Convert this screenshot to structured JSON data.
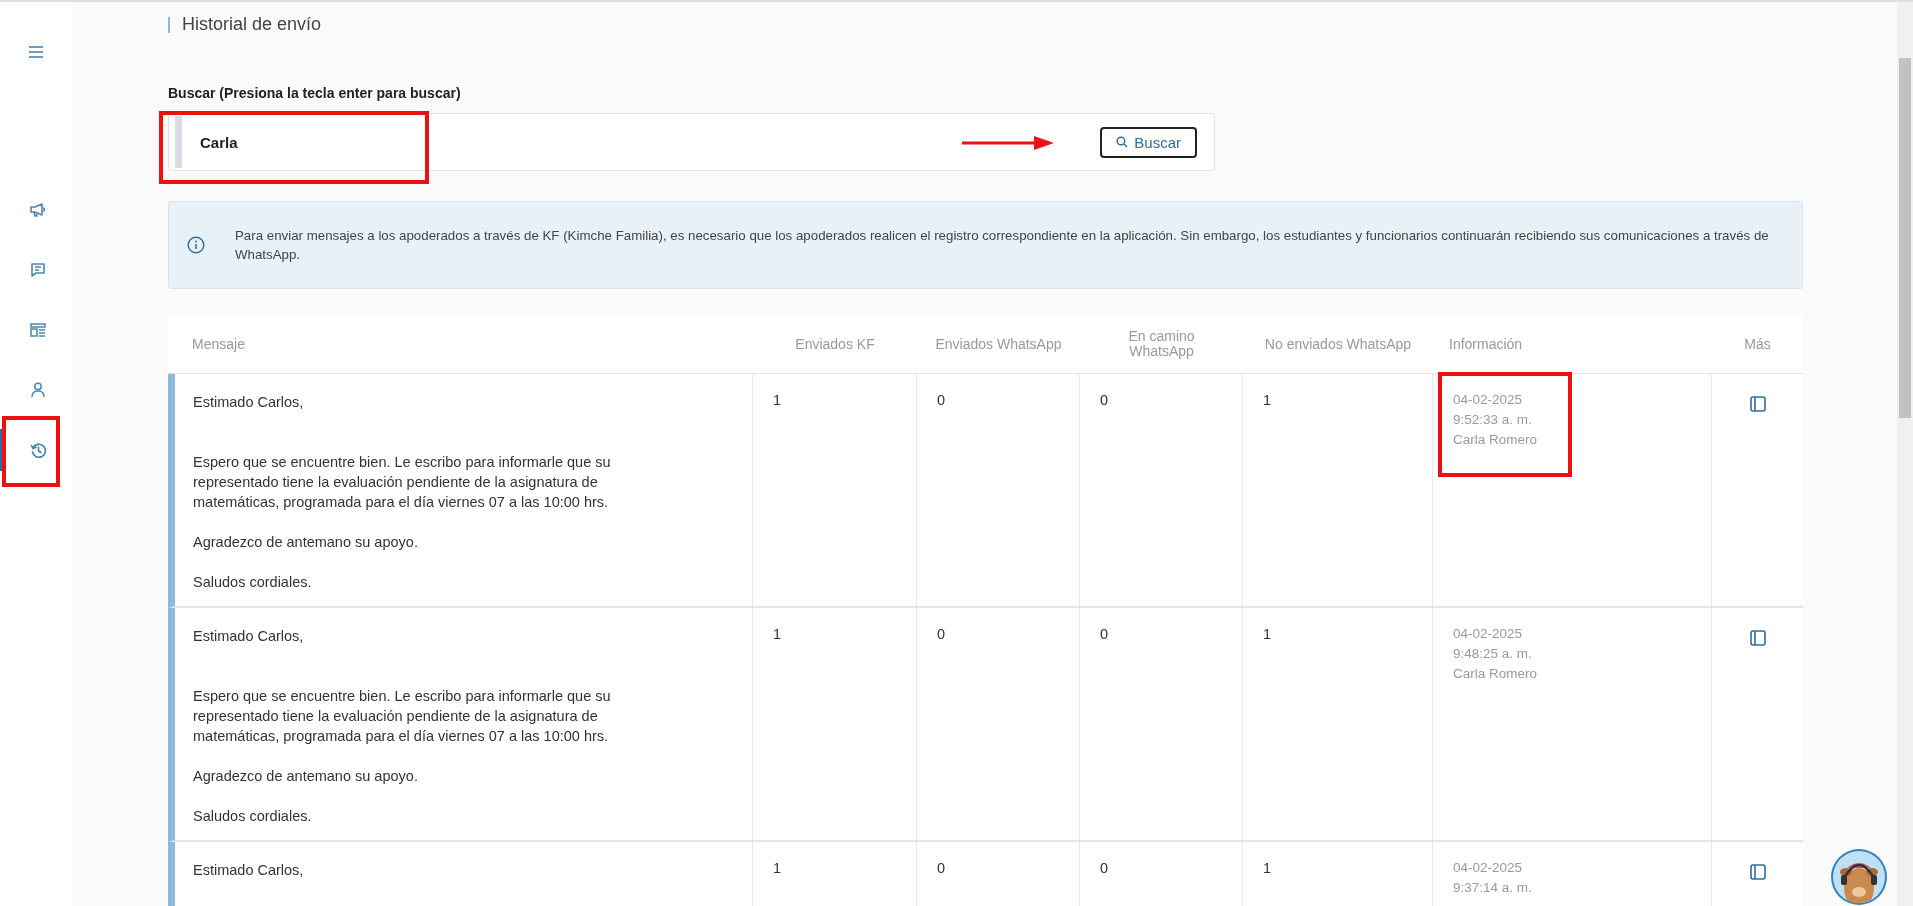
{
  "page": {
    "title": "Historial de envío"
  },
  "sidebar": {
    "items": [
      {
        "kind": "megaphone",
        "selected": false
      },
      {
        "kind": "chat",
        "selected": false
      },
      {
        "kind": "layout",
        "selected": false
      },
      {
        "kind": "person",
        "selected": false
      },
      {
        "kind": "history",
        "selected": true
      }
    ]
  },
  "search": {
    "label": "Buscar (Presiona la tecla enter para buscar)",
    "value": "Carla",
    "button": "Buscar"
  },
  "notice": "Para enviar mensajes a los apoderados a través de KF (Kimche Familia), es necesario que los apoderados realicen el registro correspondiente en la aplicación. Sin embargo, los estudiantes y funcionarios continuarán recibiendo sus comunicaciones a través de WhatsApp.",
  "table": {
    "columns": [
      "Mensaje",
      "Enviados KF",
      "Enviados WhatsApp",
      "En camino WhatsApp",
      "No enviados WhatsApp",
      "Información",
      "Más"
    ],
    "rows": [
      {
        "message": [
          "Estimado Carlos,",
          "Espero que se encuentre bien. Le escribo para informarle que su representado tiene la evaluación pendiente de la asignatura de matemáticas, programada para el día viernes 07 a las 10:00 hrs.",
          "Agradezco de antemano su apoyo.",
          "Saludos cordiales."
        ],
        "sent_kf": "1",
        "sent_whatsapp": "0",
        "on_way_whatsapp": "0",
        "not_sent_whatsapp": "1",
        "info": [
          "04-02-2025",
          "9:52:33 a. m.",
          "Carla Romero"
        ]
      },
      {
        "message": [
          "Estimado Carlos,",
          "Espero que se encuentre bien. Le escribo para informarle que su representado tiene la evaluación pendiente de la asignatura de matemáticas, programada para el día viernes 07 a las 10:00 hrs.",
          "Agradezco de antemano su apoyo.",
          "Saludos cordiales."
        ],
        "sent_kf": "1",
        "sent_whatsapp": "0",
        "on_way_whatsapp": "0",
        "not_sent_whatsapp": "1",
        "info": [
          "04-02-2025",
          "9:48:25 a. m.",
          "Carla Romero"
        ]
      },
      {
        "message": [
          "Estimado Carlos,"
        ],
        "sent_kf": "1",
        "sent_whatsapp": "0",
        "on_way_whatsapp": "0",
        "not_sent_whatsapp": "1",
        "info": [
          "04-02-2025",
          "9:37:14 a. m."
        ]
      }
    ]
  }
}
